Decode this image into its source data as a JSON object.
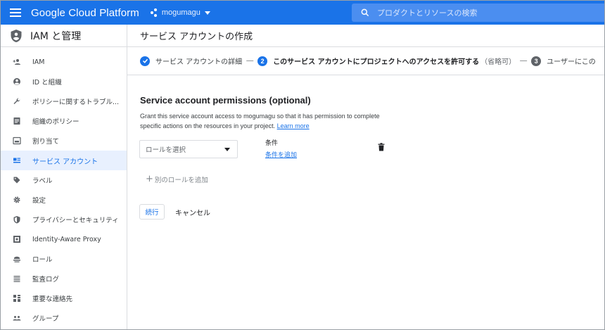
{
  "topbar": {
    "menu_icon": "hamburger-menu-icon",
    "brand": "Google Cloud Platform",
    "project_icon": "project-dots-icon",
    "project_name": "mogumagu",
    "search_placeholder": "プロダクトとリソースの検索",
    "color": "#1a73e8"
  },
  "sidebar": {
    "header_icon": "iam-shield-icon",
    "title": "IAM と管理",
    "items": [
      {
        "label": "IAM",
        "icon": "person-add-icon"
      },
      {
        "label": "ID と組織",
        "icon": "account-circle-icon"
      },
      {
        "label": "ポリシーに関するトラブル...",
        "icon": "wrench-icon"
      },
      {
        "label": "組織のポリシー",
        "icon": "document-list-icon"
      },
      {
        "label": "割り当て",
        "icon": "quota-icon"
      },
      {
        "label": "サービス アカウント",
        "icon": "service-account-icon",
        "active": true
      },
      {
        "label": "ラベル",
        "icon": "label-tag-icon"
      },
      {
        "label": "設定",
        "icon": "gear-icon"
      },
      {
        "label": "プライバシーとセキュリティ",
        "icon": "privacy-shield-icon"
      },
      {
        "label": "Identity-Aware Proxy",
        "icon": "iap-icon"
      },
      {
        "label": "ロール",
        "icon": "roles-icon"
      },
      {
        "label": "監査ログ",
        "icon": "audit-log-icon"
      },
      {
        "label": "重要な連絡先",
        "icon": "contacts-icon"
      },
      {
        "label": "グループ",
        "icon": "groups-icon"
      }
    ]
  },
  "main": {
    "title": "サービス アカウントの作成",
    "steps": [
      {
        "number": "1",
        "label": "サービス アカウントの詳細",
        "state": "done"
      },
      {
        "number": "2",
        "label": "このサービス アカウントにプロジェクトへのアクセスを許可する",
        "optional": "（省略可）",
        "state": "current"
      },
      {
        "number": "3",
        "label": "ユーザーにこの",
        "state": "todo"
      }
    ],
    "separator": "—",
    "permissions": {
      "title": "Service account permissions (optional)",
      "description": "Grant this service account access to mogumagu so that it has permission to complete specific actions on the resources in your project.",
      "learn_more": "Learn more",
      "role_select_placeholder": "ロールを選択",
      "condition_title": "条件",
      "condition_link": "条件を追加",
      "delete_icon": "trash-icon",
      "add_role": "別のロールを追加"
    },
    "buttons": {
      "continue": "続行",
      "cancel": "キャンセル"
    }
  }
}
